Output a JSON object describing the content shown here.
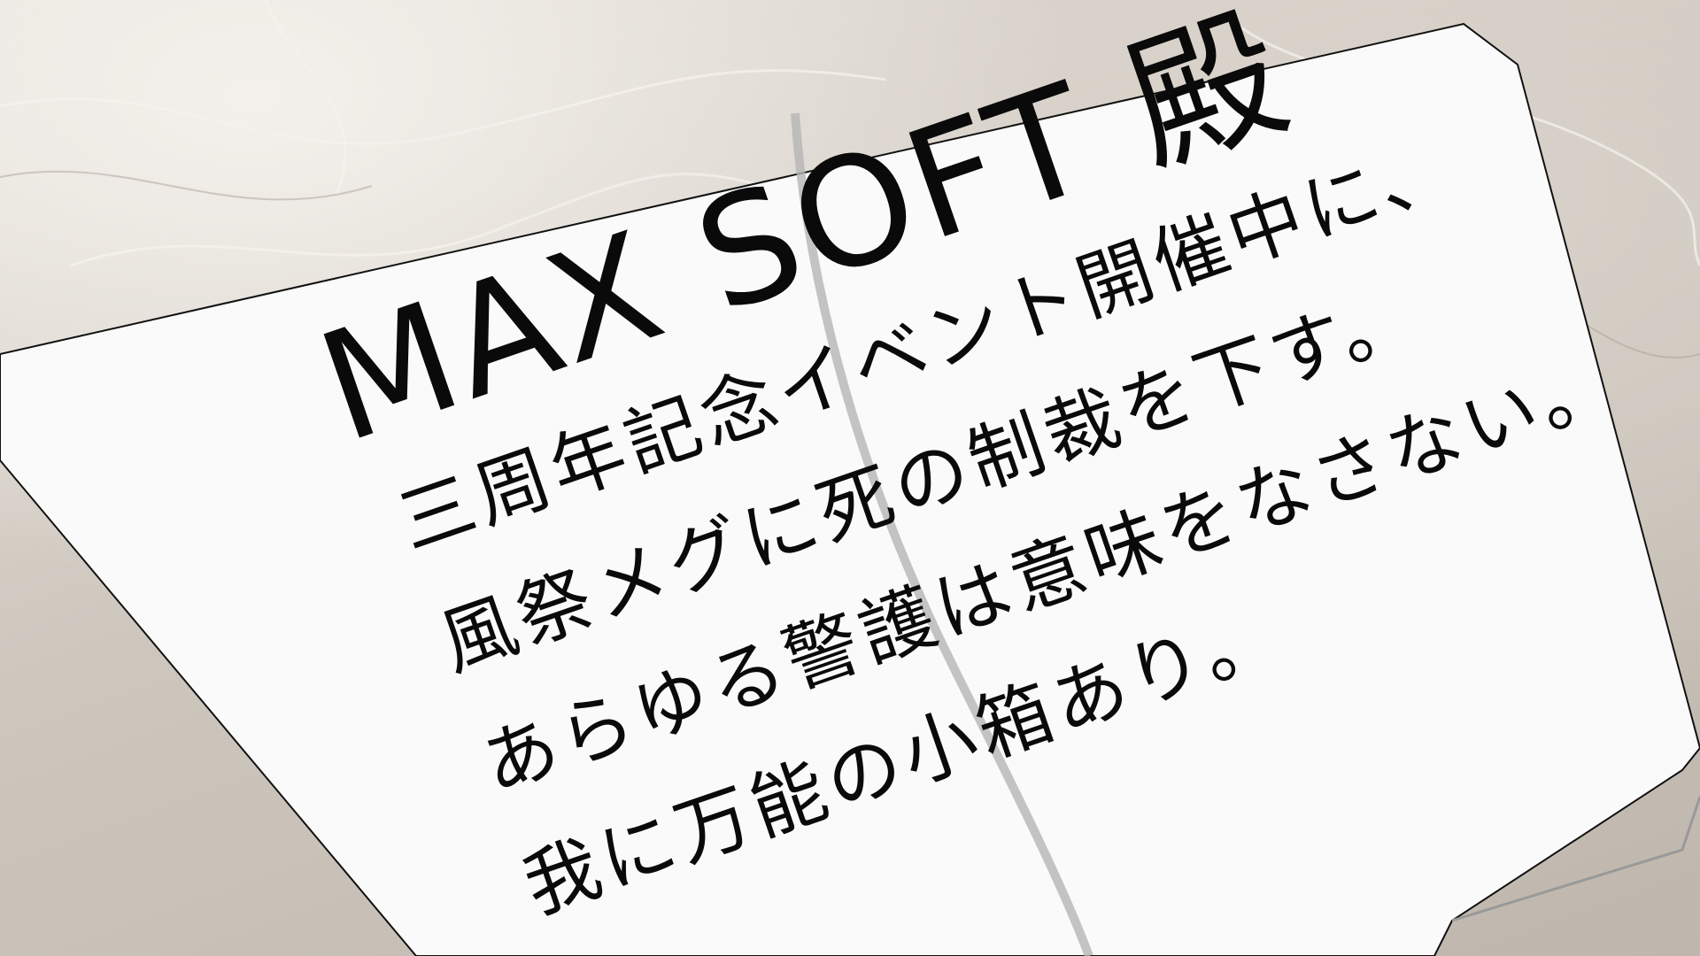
{
  "letter": {
    "title": "MAX SOFT 殿",
    "lines": [
      "三周年記念イベント開催中に、",
      "風祭メグに死の制裁を下す。",
      "あらゆる警護は意味をなさない。",
      "我に万能の小箱あり。"
    ]
  },
  "colors": {
    "paper": "#fafafa",
    "ink": "#0a0a0a",
    "background": "#cdc6bd"
  }
}
